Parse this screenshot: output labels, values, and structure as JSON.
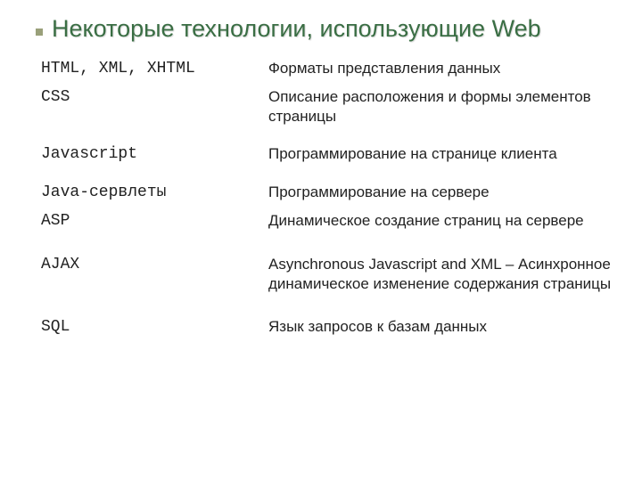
{
  "title": "Некоторые технологии, использующие Web",
  "rows": [
    {
      "tech": "HTML, XML, XHTML",
      "desc": "Форматы представления данных"
    },
    {
      "tech": "CSS",
      "desc": "Описание расположения и формы элементов страницы"
    },
    {
      "tech": "Javascript",
      "desc": "Программирование на странице клиента"
    },
    {
      "tech": "Java-сервлеты",
      "desc": "Программирование на сервере"
    },
    {
      "tech": "ASP",
      "desc": "Динамическое создание страниц на сервере"
    },
    {
      "tech": "AJAX",
      "desc": "Asynchronous Javascript and XML – Асинхронное динамическое изменение содержания страницы"
    },
    {
      "tech": "SQL",
      "desc": "Язык запросов к базам данных"
    }
  ]
}
